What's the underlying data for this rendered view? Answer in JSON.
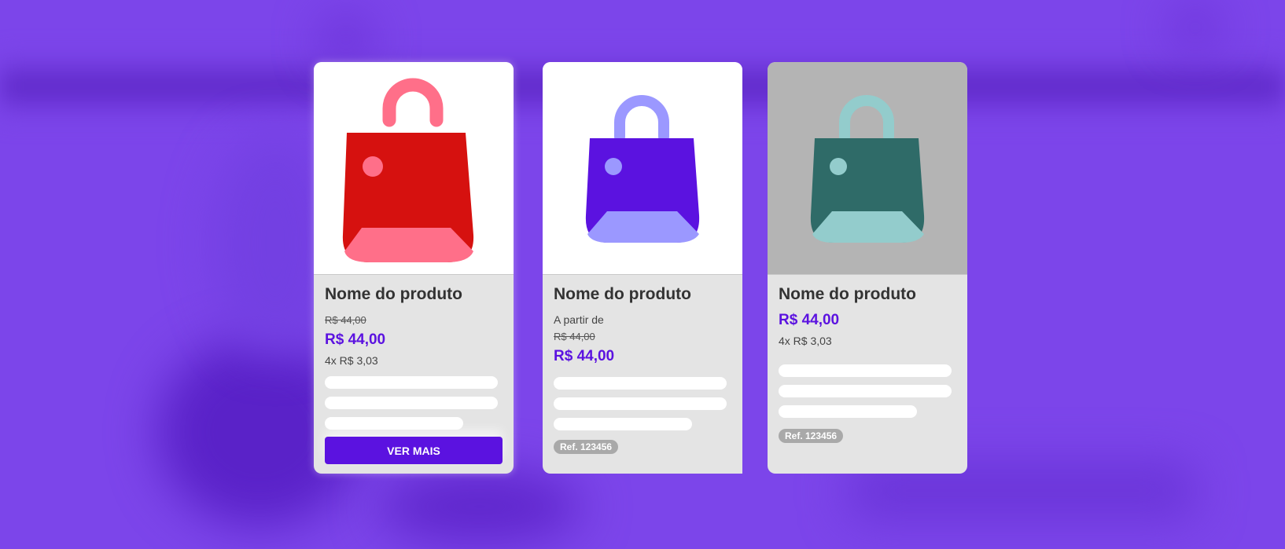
{
  "colors": {
    "background": "#7c45ea",
    "accent": "#5b12e0",
    "card_body": "#e4e4e4"
  },
  "products": [
    {
      "name": "Nome do produto",
      "old_price": "R$ 44,00",
      "price": "R$ 44,00",
      "installments": "4x R$ 3,03",
      "button_label": "VER MAIS",
      "bag_icon": "shopping-bag-icon",
      "bag_colors": {
        "body": "#d6110f",
        "accent": "#ff6f89"
      }
    },
    {
      "name": "Nome do produto",
      "price_prefix": "A partir de",
      "old_price": "R$ 44,00",
      "price": "R$ 44,00",
      "reference": "Ref. 123456",
      "bag_icon": "shopping-bag-icon",
      "bag_colors": {
        "body": "#5b12e0",
        "accent": "#9b98ff"
      }
    },
    {
      "name": "Nome do produto",
      "price": "R$ 44,00",
      "installments": "4x R$ 3,03",
      "reference": "Ref. 123456",
      "bag_icon": "shopping-bag-icon",
      "bag_colors": {
        "body": "#2f6b68",
        "accent": "#93cccc"
      }
    }
  ]
}
